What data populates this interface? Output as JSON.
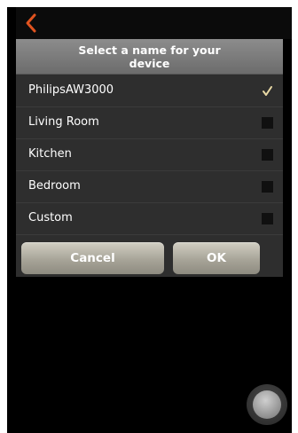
{
  "header": {
    "back_icon": "chevron-left-icon",
    "back_icon_color": "#e0531f"
  },
  "dialog": {
    "title": "Select a name for your device",
    "options": [
      {
        "label": "PhilipsAW3000",
        "selected": true
      },
      {
        "label": "Living Room",
        "selected": false
      },
      {
        "label": "Kitchen",
        "selected": false
      },
      {
        "label": "Bedroom",
        "selected": false
      },
      {
        "label": "Custom",
        "selected": false
      }
    ],
    "check_color": "#e9d9a5",
    "cancel_label": "Cancel",
    "ok_label": "OK"
  },
  "assistive_touch": {
    "icon": "assistive-touch-icon"
  }
}
